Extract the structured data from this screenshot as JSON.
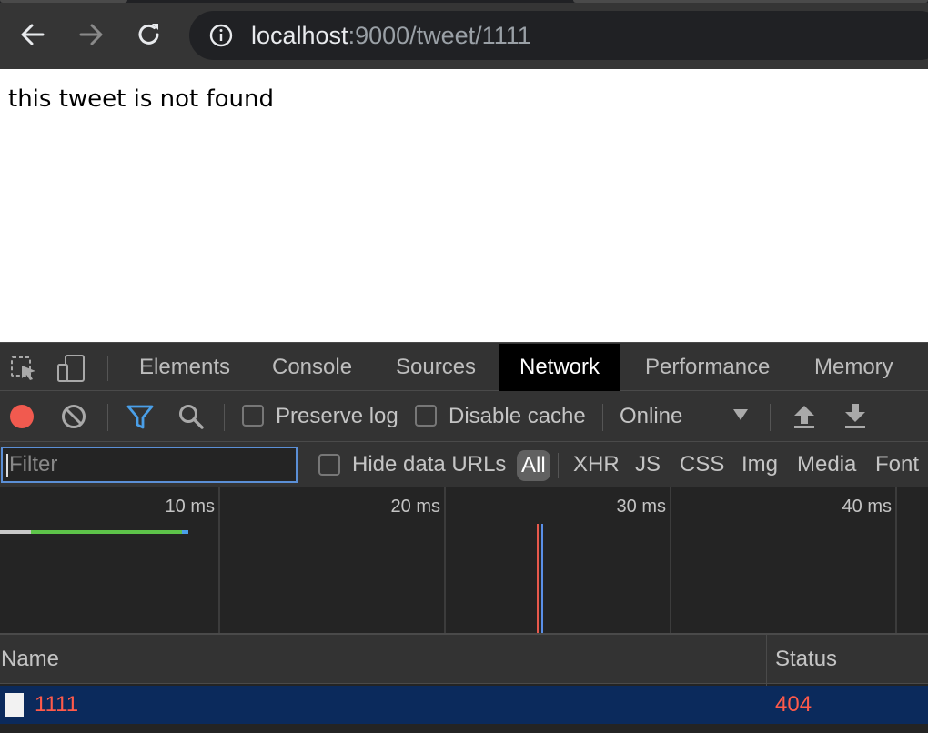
{
  "browser": {
    "url_host": "localhost",
    "url_rest": ":9000/tweet/1111"
  },
  "page": {
    "body_text": "this tweet is not found"
  },
  "devtools": {
    "tabs": [
      {
        "label": "Elements"
      },
      {
        "label": "Console"
      },
      {
        "label": "Sources"
      },
      {
        "label": "Network"
      },
      {
        "label": "Performance"
      },
      {
        "label": "Memory"
      }
    ],
    "active_tab": "Network",
    "toolbar": {
      "preserve_log_label": "Preserve log",
      "disable_cache_label": "Disable cache",
      "throttling_value": "Online"
    },
    "filter": {
      "placeholder": "Filter",
      "hide_data_urls_label": "Hide data URLs",
      "types": [
        "All",
        "XHR",
        "JS",
        "CSS",
        "Img",
        "Media",
        "Font"
      ],
      "selected_type": "All"
    },
    "overview": {
      "ticks": [
        "10 ms",
        "20 ms",
        "30 ms",
        "40 ms"
      ]
    },
    "table": {
      "columns": [
        "Name",
        "Status"
      ],
      "rows": [
        {
          "name": "1111",
          "status": "404"
        }
      ]
    }
  },
  "colors": {
    "record_red": "#f15a4f",
    "error_text": "#ff5a4a",
    "selected_row": "#0b2a5c",
    "filter_blue": "#4a9fe8"
  }
}
